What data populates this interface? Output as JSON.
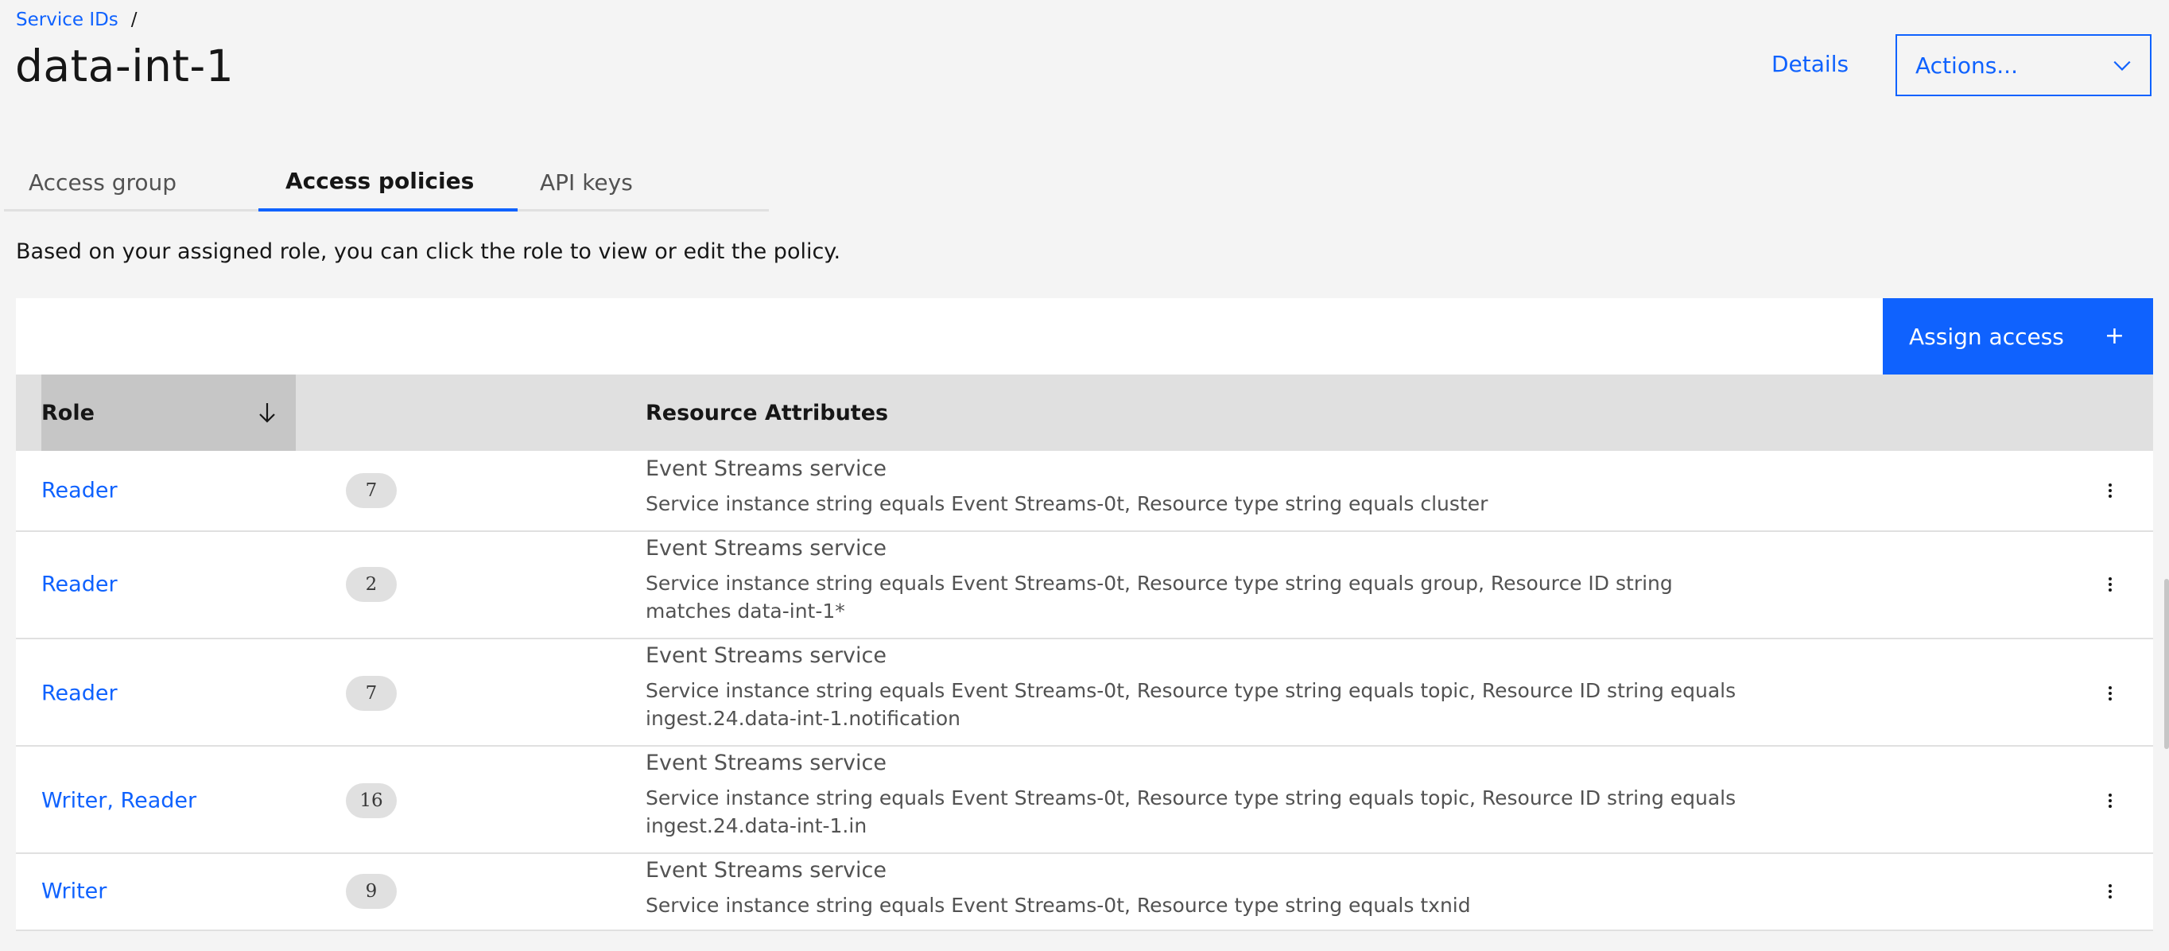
{
  "breadcrumb": {
    "link": "Service IDs",
    "separator": "/"
  },
  "page": {
    "title": "data-int-1"
  },
  "header": {
    "details_label": "Details",
    "actions_label": "Actions..."
  },
  "tabs": [
    {
      "label": "Access group",
      "active": false
    },
    {
      "label": "Access policies",
      "active": true
    },
    {
      "label": "API keys",
      "active": false
    }
  ],
  "description": "Based on your assigned role, you can click the role to view or edit the policy.",
  "toolbar": {
    "assign_label": "Assign access",
    "assign_icon": "+"
  },
  "table": {
    "headers": {
      "role": "Role",
      "attributes": "Resource Attributes"
    },
    "rows": [
      {
        "role": "Reader",
        "count": "7",
        "service": "Event Streams service",
        "detail": "Service instance string equals Event Streams-0t, Resource type string equals cluster"
      },
      {
        "role": "Reader",
        "count": "2",
        "service": "Event Streams service",
        "detail": "Service instance string equals Event Streams-0t, Resource type string equals group, Resource ID string matches data-int-1*"
      },
      {
        "role": "Reader",
        "count": "7",
        "service": "Event Streams service",
        "detail": "Service instance string equals Event Streams-0t, Resource type string equals topic, Resource ID string equals ingest.24.data-int-1.notification"
      },
      {
        "role": "Writer, Reader",
        "count": "16",
        "service": "Event Streams service",
        "detail": "Service instance string equals Event Streams-0t, Resource type string equals topic, Resource ID string equals ingest.24.data-int-1.in"
      },
      {
        "role": "Writer",
        "count": "9",
        "service": "Event Streams service",
        "detail": "Service instance string equals Event Streams-0t, Resource type string equals txnid"
      }
    ]
  },
  "colors": {
    "accent": "#0f62fe",
    "background": "#f4f4f4",
    "header": "#e0e0e0",
    "sorted_header": "#c6c6c6"
  },
  "icons": {
    "sort": "arrow-down-icon",
    "actions": "chevron-down-icon",
    "row_menu": "overflow-menu-vertical-icon"
  }
}
